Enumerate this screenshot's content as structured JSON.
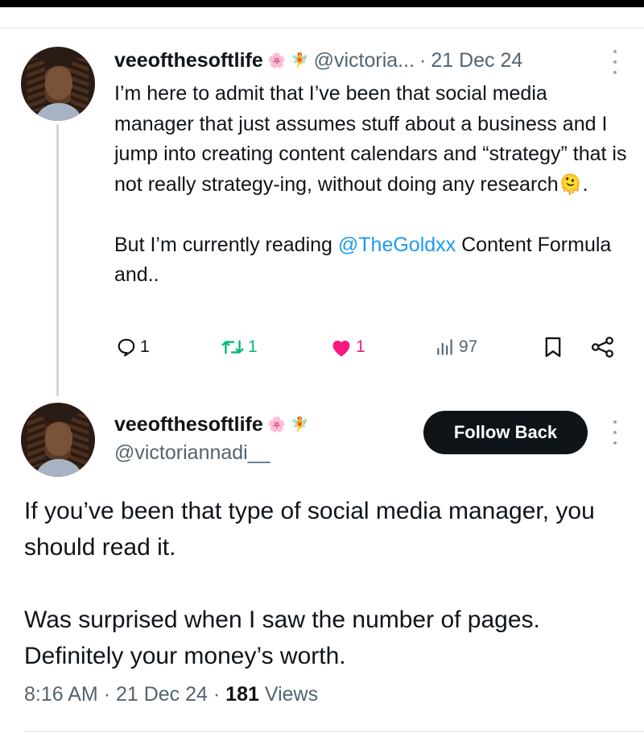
{
  "reply_tweet": {
    "display_name": "veeofthesoftlife",
    "name_emojis": [
      "🌸",
      "🧚"
    ],
    "handle": "@victoria...",
    "separator": "·",
    "date": "21 Dec 24",
    "text_paragraph_1": "I’m here to admit that I’ve been that social media manager that just assumes stuff about a business and I jump into creating content calendars and “strategy” that is not really strategy-ing, without doing any research",
    "text_emoji": "🫠",
    "text_paragraph_1_end": ".",
    "text_paragraph_2_before": "But I’m currently reading ",
    "mention": "@TheGoldxx",
    "text_paragraph_2_after": " Content Formula and..",
    "actions": {
      "replies": "1",
      "retweets": "1",
      "likes": "1",
      "views": "97"
    }
  },
  "main_tweet": {
    "display_name": "veeofthesoftlife",
    "name_emojis": [
      "🌸",
      "🧚"
    ],
    "handle": "@victoriannadi__",
    "follow_button_label": "Follow Back",
    "paragraph_1": "If you’ve been that type of social media manager, you should read it.",
    "paragraph_2": "Was surprised when I saw the number of pages. Definitely your money’s worth.",
    "time": "8:16 AM",
    "date": "21 Dec 24",
    "views_count": "181",
    "views_label": "Views",
    "separator": "·"
  },
  "colors": {
    "accent_link": "#1d9bf0",
    "retweet_green": "#00ba7c",
    "like_pink": "#f91880",
    "text_primary": "#0f1419",
    "text_secondary": "#536471",
    "button_bg": "#0f1419"
  },
  "icons": [
    "reply-icon",
    "retweet-icon",
    "heart-icon",
    "views-chart-icon",
    "bookmark-icon",
    "share-icon",
    "more-icon"
  ]
}
